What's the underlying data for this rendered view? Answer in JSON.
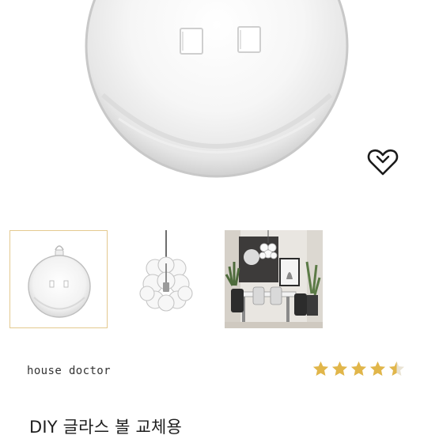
{
  "product": {
    "hero_image": "glass-ball-photo",
    "wishlist_icon": "heart-outline-icon",
    "thumbnails": [
      {
        "image": "glass-ball-ornament",
        "selected": true
      },
      {
        "image": "glass-bubble-pendant-lamp",
        "selected": false
      },
      {
        "image": "dining-room-scene",
        "selected": false
      }
    ],
    "brand": "house doctor",
    "rating": 4.5,
    "rating_max": 5,
    "star_color": "#e1b64a",
    "title": "DIY 글라스 볼 교체용"
  }
}
